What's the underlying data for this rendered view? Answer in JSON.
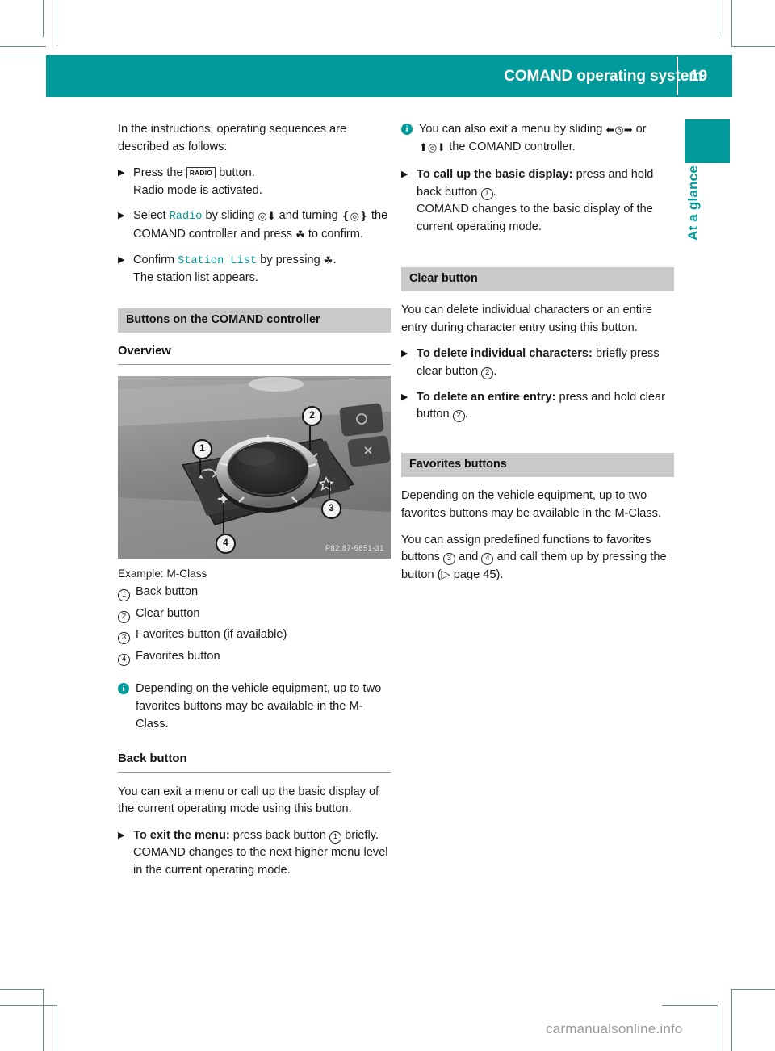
{
  "header": {
    "title": "COMAND operating system",
    "page_number": "19",
    "edge_tab_label": "At a glance"
  },
  "colors": {
    "accent_teal": "#019a9a",
    "section_header_gray": "#c9c9c9",
    "text": "#1a1a1a",
    "watermark_gray": "#9a9a9a"
  },
  "left_column": {
    "intro": "In the instructions, operating sequences are described as follows:",
    "steps": [
      {
        "pre": "Press the ",
        "keycap": "RADIO",
        "post": " button.",
        "result": "Radio mode is activated."
      },
      {
        "pre": "Select ",
        "menu": "Radio",
        "mid": " by sliding ",
        "glyph1": "slide-down-icon",
        "mid2": " and turning ",
        "glyph2": "turn-controller-icon",
        "mid3": " the COMAND controller and press ",
        "glyph3": "press-controller-icon",
        "post": " to confirm."
      },
      {
        "pre": "Confirm ",
        "menu": "Station List",
        "mid": " by pressing ",
        "glyph1": "press-controller-icon",
        "post": ".",
        "result": "The station list appears."
      }
    ],
    "section_header": "Buttons on the COMAND controller",
    "sub_header": "Overview",
    "figure": {
      "caption": "Example: M-Class",
      "photo_code": "P82.87-6851-31",
      "callouts": [
        "1",
        "2",
        "3",
        "4"
      ],
      "legend": [
        {
          "num": "1",
          "label": "Back button"
        },
        {
          "num": "2",
          "label": "Clear button"
        },
        {
          "num": "3",
          "label": "Favorites button (if available)"
        },
        {
          "num": "4",
          "label": "Favorites button"
        }
      ]
    },
    "note": "Depending on the vehicle equipment, up to two favorites buttons may be available in the M-Class.",
    "back_button": {
      "heading": "Back button",
      "body": "You can exit a menu or call up the basic display of the current operating mode using this button.",
      "step_bold": "To exit the menu:",
      "step_rest": " press back button ",
      "step_num": "1",
      "step_after": " briefly.",
      "step_result": "COMAND changes to the next higher menu level in the current operating mode."
    }
  },
  "right_column": {
    "note": {
      "pre": "You can also exit a menu by sliding ",
      "glyph1": "slide-left-right-icon",
      "mid": " or ",
      "glyph2": "slide-up-down-icon",
      "post": " the COMAND controller."
    },
    "basic_display_step": {
      "bold": "To call up the basic display:",
      "rest": " press and hold back button ",
      "num": "1",
      "after": ".",
      "result": "COMAND changes to the basic display of the current operating mode."
    },
    "clear_button": {
      "heading": "Clear button",
      "body": "You can delete individual characters or an entire entry during character entry using this button.",
      "steps": [
        {
          "bold": "To delete individual characters:",
          "rest": " briefly press clear button ",
          "num": "2",
          "after": "."
        },
        {
          "bold": "To delete an entire entry:",
          "rest": " press and hold clear button ",
          "num": "2",
          "after": "."
        }
      ]
    },
    "favorites_buttons": {
      "heading": "Favorites buttons",
      "body1": "Depending on the vehicle equipment, up to two favorites buttons may be available in the M-Class.",
      "body2_pre": "You can assign predefined functions to favorites buttons ",
      "num1": "3",
      "body2_mid": " and ",
      "num2": "4",
      "body2_post": " and call them up by pressing the button (",
      "page_ref": "page 45",
      "body2_end": ")."
    }
  },
  "watermark": "carmanualsonline.info"
}
